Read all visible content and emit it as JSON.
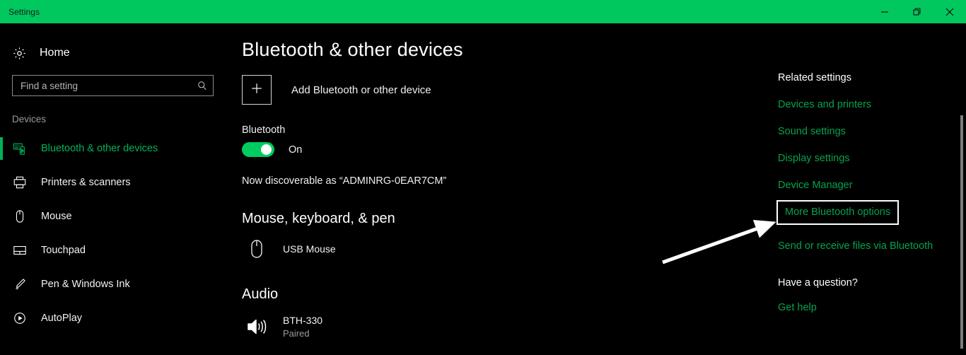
{
  "window": {
    "title": "Settings",
    "accent_green": "#00c85e",
    "link_green": "#06a24e",
    "background": "#000000",
    "controls": [
      {
        "name": "minimize",
        "glyph": "minimize-icon"
      },
      {
        "name": "restore",
        "glyph": "restore-icon"
      },
      {
        "name": "close",
        "glyph": "close-icon"
      }
    ]
  },
  "sidebar": {
    "home_label": "Home",
    "home_icon": "gear-icon",
    "search": {
      "placeholder": "Find a setting",
      "value": "",
      "icon": "search-icon"
    },
    "group_label": "Devices",
    "items": [
      {
        "label": "Bluetooth & other devices",
        "icon": "bluetooth-devices-icon",
        "active": true
      },
      {
        "label": "Printers & scanners",
        "icon": "printer-icon",
        "active": false
      },
      {
        "label": "Mouse",
        "icon": "mouse-icon",
        "active": false
      },
      {
        "label": "Touchpad",
        "icon": "touchpad-icon",
        "active": false
      },
      {
        "label": "Pen & Windows Ink",
        "icon": "pen-icon",
        "active": false
      },
      {
        "label": "AutoPlay",
        "icon": "autoplay-icon",
        "active": false
      }
    ]
  },
  "main": {
    "page_title": "Bluetooth & other devices",
    "add_device": {
      "label": "Add Bluetooth or other device",
      "icon": "plus-icon"
    },
    "bluetooth": {
      "label": "Bluetooth",
      "state": "On",
      "toggle_on": true,
      "toggle_color": "#00cc5f"
    },
    "discoverable_text": "Now discoverable as “ADMINRG-0EAR7CM”",
    "sections": [
      {
        "heading": "Mouse, keyboard, & pen",
        "devices": [
          {
            "name": "USB Mouse",
            "status": "",
            "icon": "mouse-icon"
          }
        ]
      },
      {
        "heading": "Audio",
        "devices": [
          {
            "name": "BTH-330",
            "status": "Paired",
            "icon": "speaker-icon"
          }
        ]
      }
    ]
  },
  "related": {
    "heading": "Related settings",
    "links": [
      {
        "label": "Devices and printers",
        "highlighted": false
      },
      {
        "label": "Sound settings",
        "highlighted": false
      },
      {
        "label": "Display settings",
        "highlighted": false
      },
      {
        "label": "Device Manager",
        "highlighted": false
      },
      {
        "label": "More Bluetooth options",
        "highlighted": true
      },
      {
        "label": "Send or receive files via Bluetooth",
        "highlighted": false
      }
    ],
    "question_heading": "Have a question?",
    "help_label": "Get help"
  },
  "annotation": {
    "arrow": "white-arrow-pointing-to-more-bluetooth-options"
  }
}
